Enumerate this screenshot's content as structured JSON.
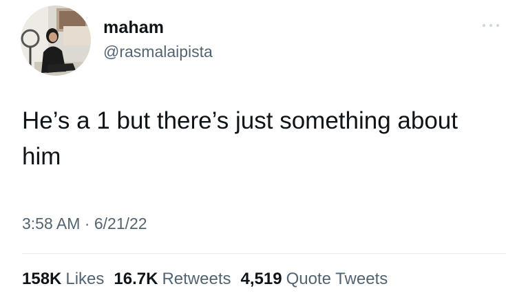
{
  "user": {
    "display_name": "maham",
    "handle": "@rasmalaipista",
    "avatar_icon": "profile-photo-avatar"
  },
  "tweet": {
    "text": "He’s a 1 but there’s just something about him",
    "time": "3:58 AM",
    "separator": "·",
    "date": "6/21/22"
  },
  "stats": {
    "likes_count": "158K",
    "likes_label": "Likes",
    "retweets_count": "16.7K",
    "retweets_label": "Retweets",
    "quotes_count": "4,519",
    "quotes_label": "Quote Tweets"
  },
  "icons": {
    "more": "more-dots-icon"
  },
  "colors": {
    "primary_text": "#0f1419",
    "secondary_text": "#536471",
    "divider": "#e7eaed",
    "background": "#ffffff"
  }
}
